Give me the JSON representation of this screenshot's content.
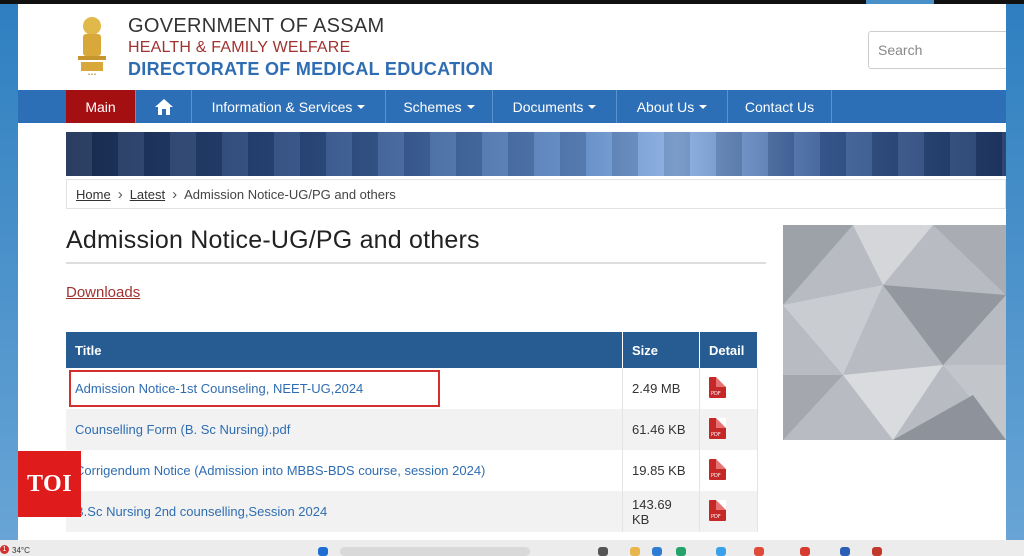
{
  "header": {
    "line1": "GOVERNMENT OF ASSAM",
    "line2": "HEALTH & FAMILY WELFARE",
    "line3": "DIRECTORATE OF MEDICAL EDUCATION",
    "search_placeholder": "Search"
  },
  "nav": {
    "items": [
      {
        "label": "Main"
      },
      {
        "label": "Information & Services"
      },
      {
        "label": "Schemes"
      },
      {
        "label": "Documents"
      },
      {
        "label": "About Us"
      },
      {
        "label": "Contact Us"
      }
    ]
  },
  "breadcrumb": [
    "Home",
    "Latest",
    "Admission Notice-UG/PG and others"
  ],
  "page_title": "Admission Notice-UG/PG and others",
  "downloads_label": "Downloads",
  "table": {
    "headers": [
      "Title",
      "Size",
      "Detail"
    ],
    "rows": [
      {
        "title": "Admission Notice-1st Counseling, NEET-UG,2024",
        "size": "2.49 MB"
      },
      {
        "title": "Counselling Form (B. Sc Nursing).pdf",
        "size": "61.46 KB"
      },
      {
        "title": "Corrigendum Notice (Admission into MBBS-BDS course, session 2024)",
        "size": "19.85 KB"
      },
      {
        "title": "B.Sc Nursing 2nd counselling,Session 2024",
        "size": "143.69 KB"
      }
    ]
  },
  "toi_logo": "TOI",
  "taskbar": {
    "weather": "34°C",
    "badge": "1"
  },
  "colors": {
    "nav": "#2c6fb6",
    "main_tab": "#a40f12",
    "table_header": "#275c93",
    "highlight": "#d32f2f",
    "toi": "#e01b1b"
  },
  "icons": [
    "emblem-icon",
    "home-icon",
    "pdf-icon",
    "search-icon"
  ]
}
